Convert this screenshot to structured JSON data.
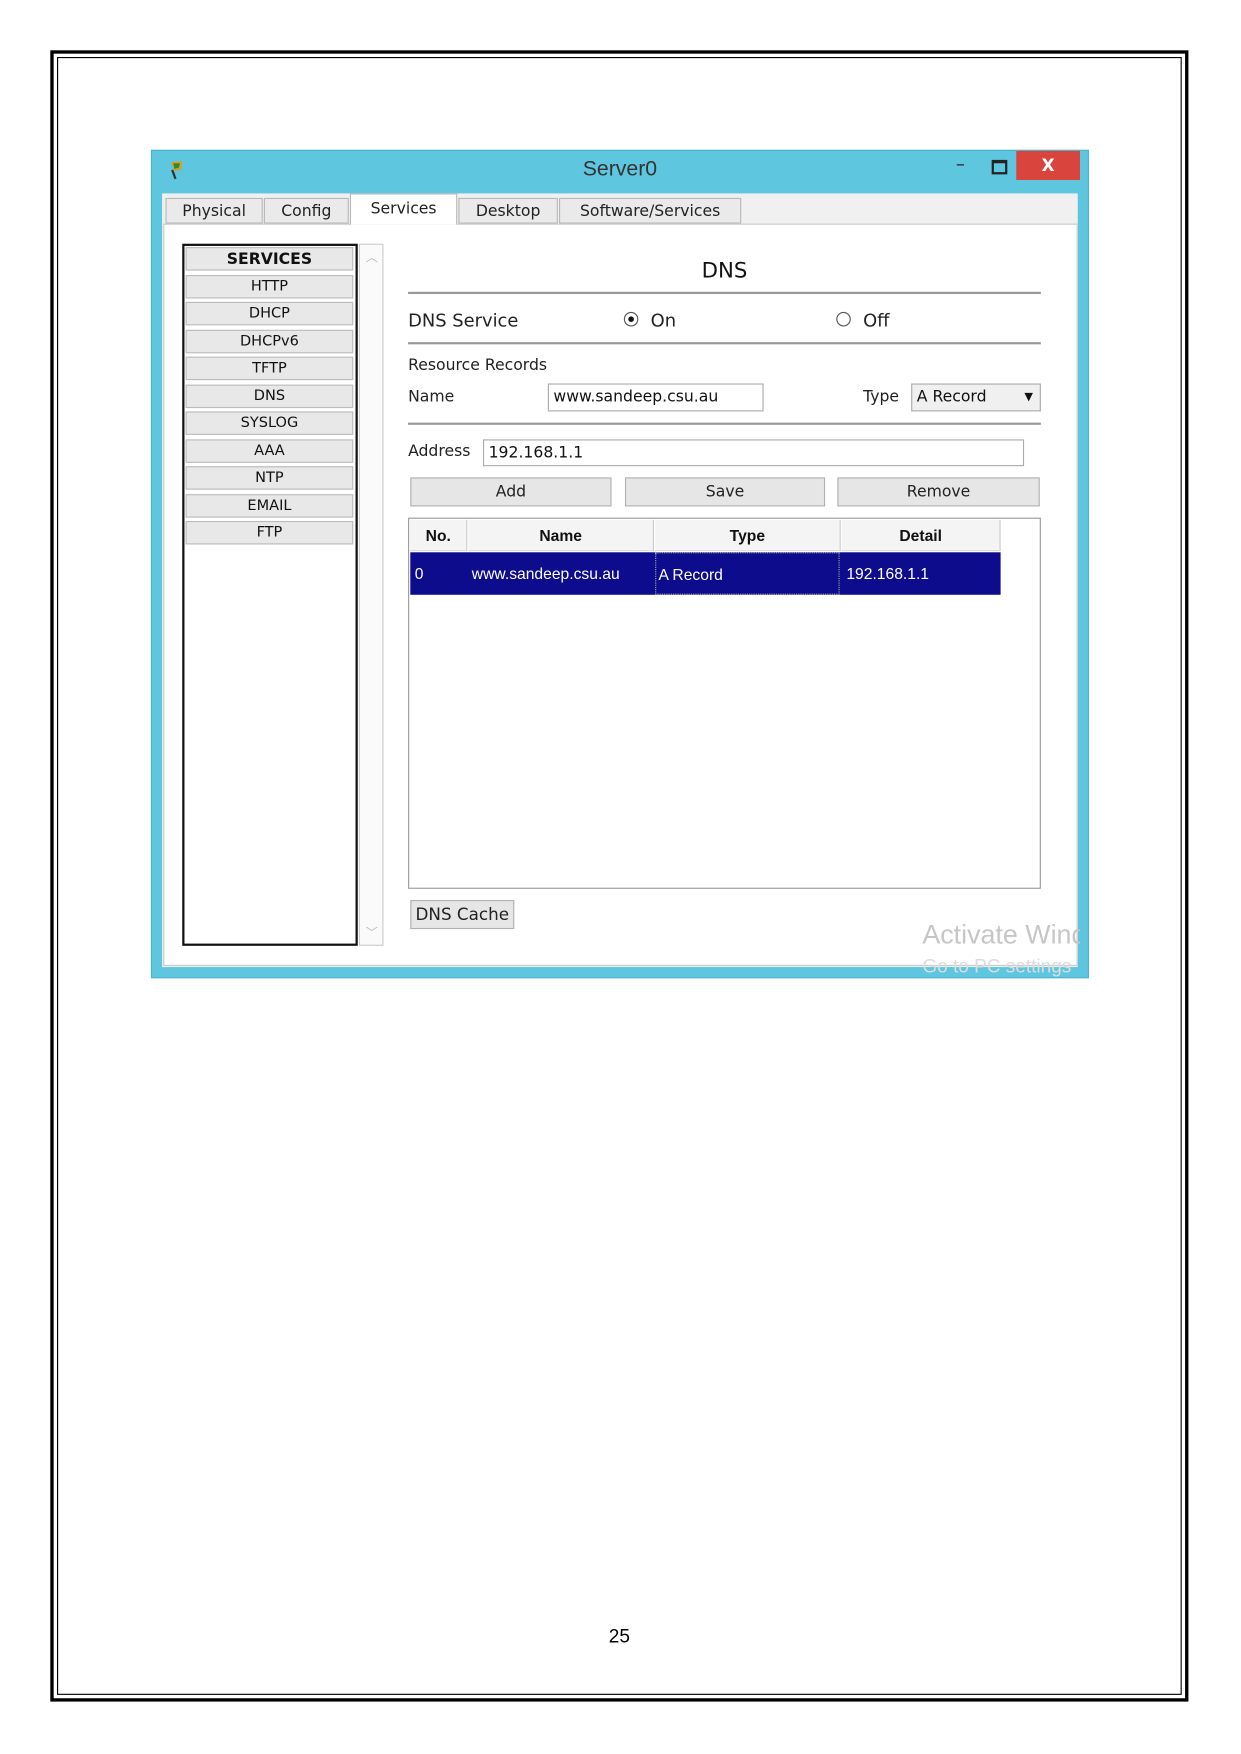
{
  "window": {
    "title": "Server0",
    "minimize": "–",
    "close": "X",
    "accent": "#5fc6e0",
    "close_color": "#d9453d"
  },
  "tabs": [
    {
      "label": "Physical"
    },
    {
      "label": "Config"
    },
    {
      "label": "Services",
      "active": true
    },
    {
      "label": "Desktop"
    },
    {
      "label": "Software/Services"
    }
  ],
  "sidebar": {
    "header": "SERVICES",
    "items": [
      "HTTP",
      "DHCP",
      "DHCPv6",
      "TFTP",
      "DNS",
      "SYSLOG",
      "AAA",
      "NTP",
      "EMAIL",
      "FTP"
    ]
  },
  "dns": {
    "heading": "DNS",
    "service_label": "DNS Service",
    "on_label": "On",
    "off_label": "Off",
    "service_state": "On",
    "resource_records_label": "Resource Records",
    "name_label": "Name",
    "name_value": "www.sandeep.csu.au",
    "type_label": "Type",
    "type_value": "A Record",
    "address_label": "Address",
    "address_value": "192.168.1.1",
    "add_label": "Add",
    "save_label": "Save",
    "remove_label": "Remove",
    "table": {
      "headers": [
        "No.",
        "Name",
        "Type",
        "Detail"
      ],
      "rows": [
        [
          "0",
          "www.sandeep.csu.au",
          "A Record",
          "192.168.1.1"
        ]
      ],
      "selected_color": "#0c0c8c"
    },
    "dns_cache_label": "DNS Cache"
  },
  "watermark": {
    "line1": "Activate Windows",
    "line2": "Go to PC settings"
  },
  "page_number": "25"
}
